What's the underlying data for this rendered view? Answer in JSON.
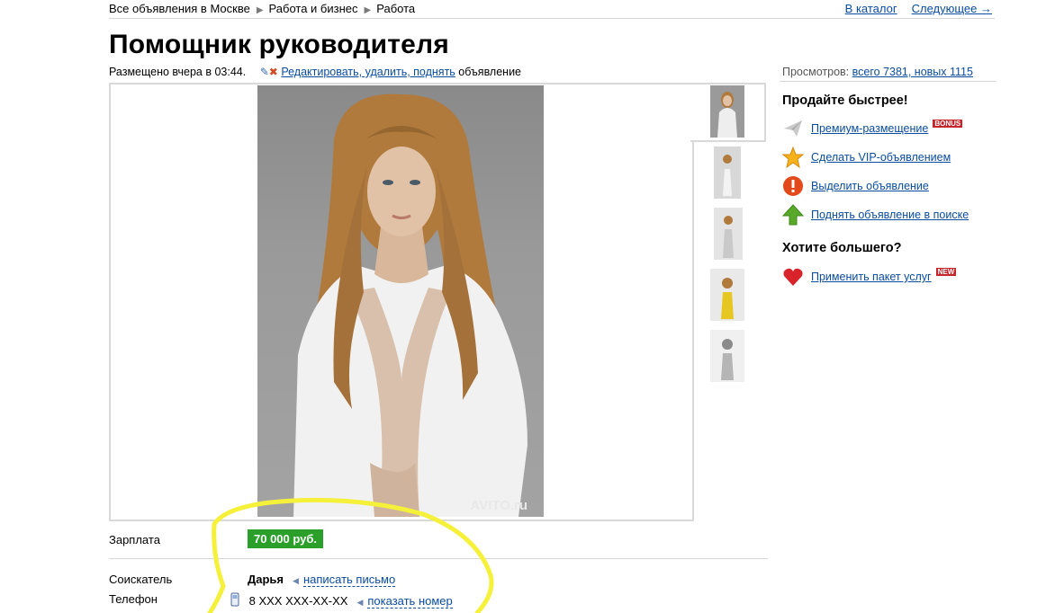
{
  "breadcrumb": {
    "items": [
      "Все объявления в Москве",
      "Работа и бизнес",
      "Работа"
    ]
  },
  "topnav": {
    "catalog": "В каталог",
    "next": "Следующее →"
  },
  "ad": {
    "title": "Помощник руководителя",
    "posted": "Размещено вчера в 03:44.",
    "edit_link": "Редактировать, удалить, поднять",
    "edit_suffix": "объявление",
    "watermark": "AVITO.ru"
  },
  "views": {
    "label": "Просмотров:",
    "value": "всего 7381, новых 1115"
  },
  "promo": {
    "heading": "Продайте быстрее!",
    "items": [
      {
        "label": "Премиум-размещение",
        "icon": "paper-plane-icon",
        "badge": "BONUS"
      },
      {
        "label": "Сделать VIP-объявлением",
        "icon": "star-icon"
      },
      {
        "label": "Выделить объявление",
        "icon": "exclamation-icon"
      },
      {
        "label": "Поднять объявление в поиске",
        "icon": "up-arrow-icon"
      }
    ],
    "heading2": "Хотите большего?",
    "package": {
      "label": "Применить пакет услуг",
      "icon": "heart-icon",
      "badge": "NEW"
    }
  },
  "details": {
    "salary_label": "Зарплата",
    "salary_value": "70 000 руб.",
    "applicant_label": "Соискатель",
    "applicant_name": "Дарья",
    "write_link": "написать письмо",
    "phone_label": "Телефон",
    "phone_value": "8 XXX XXX-XX-XX",
    "show_phone_link": "показать номер"
  },
  "colors": {
    "link": "#0a4ca0",
    "salary_bg": "#2aa02a",
    "highlight": "#f5f03a",
    "badge": "#c6232b"
  }
}
